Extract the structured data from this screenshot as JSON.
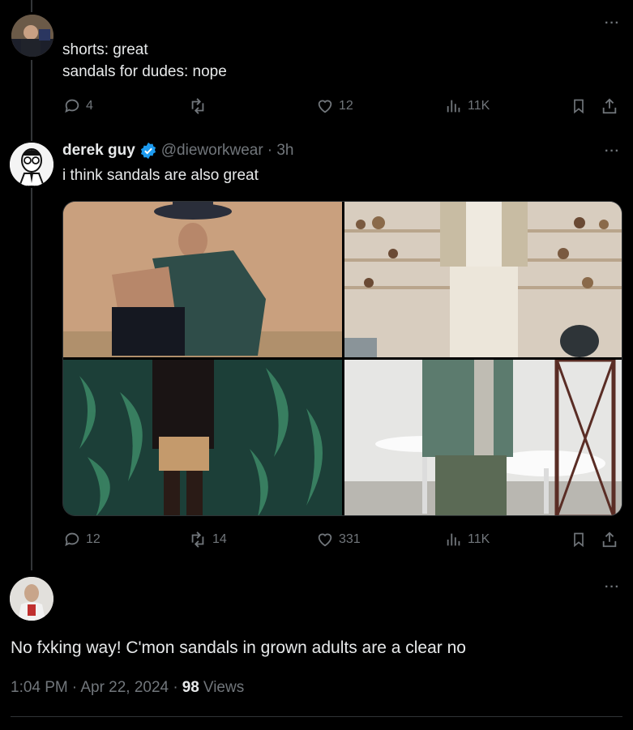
{
  "tweet1": {
    "text_line1": "shorts: great",
    "text_line2": "sandals for dudes: nope",
    "replies": "4",
    "retweets": "",
    "likes": "12",
    "views": "11K"
  },
  "tweet2": {
    "name": "derek guy",
    "handle": "@dieworkwear",
    "time": "· 3h",
    "text": "i think sandals are also great",
    "replies": "12",
    "retweets": "14",
    "likes": "331",
    "views": "11K"
  },
  "main_tweet": {
    "text": "No fxking way! C'mon sandals in grown adults are a clear no",
    "time": "1:04 PM",
    "date": "· Apr 22, 2024 ·",
    "views_count": "98",
    "views_label": "Views"
  },
  "more_glyph": "···",
  "colors": {
    "background": "#000000",
    "text": "#e7e9ea",
    "muted": "#71767b",
    "verified": "#1d9bf0"
  }
}
